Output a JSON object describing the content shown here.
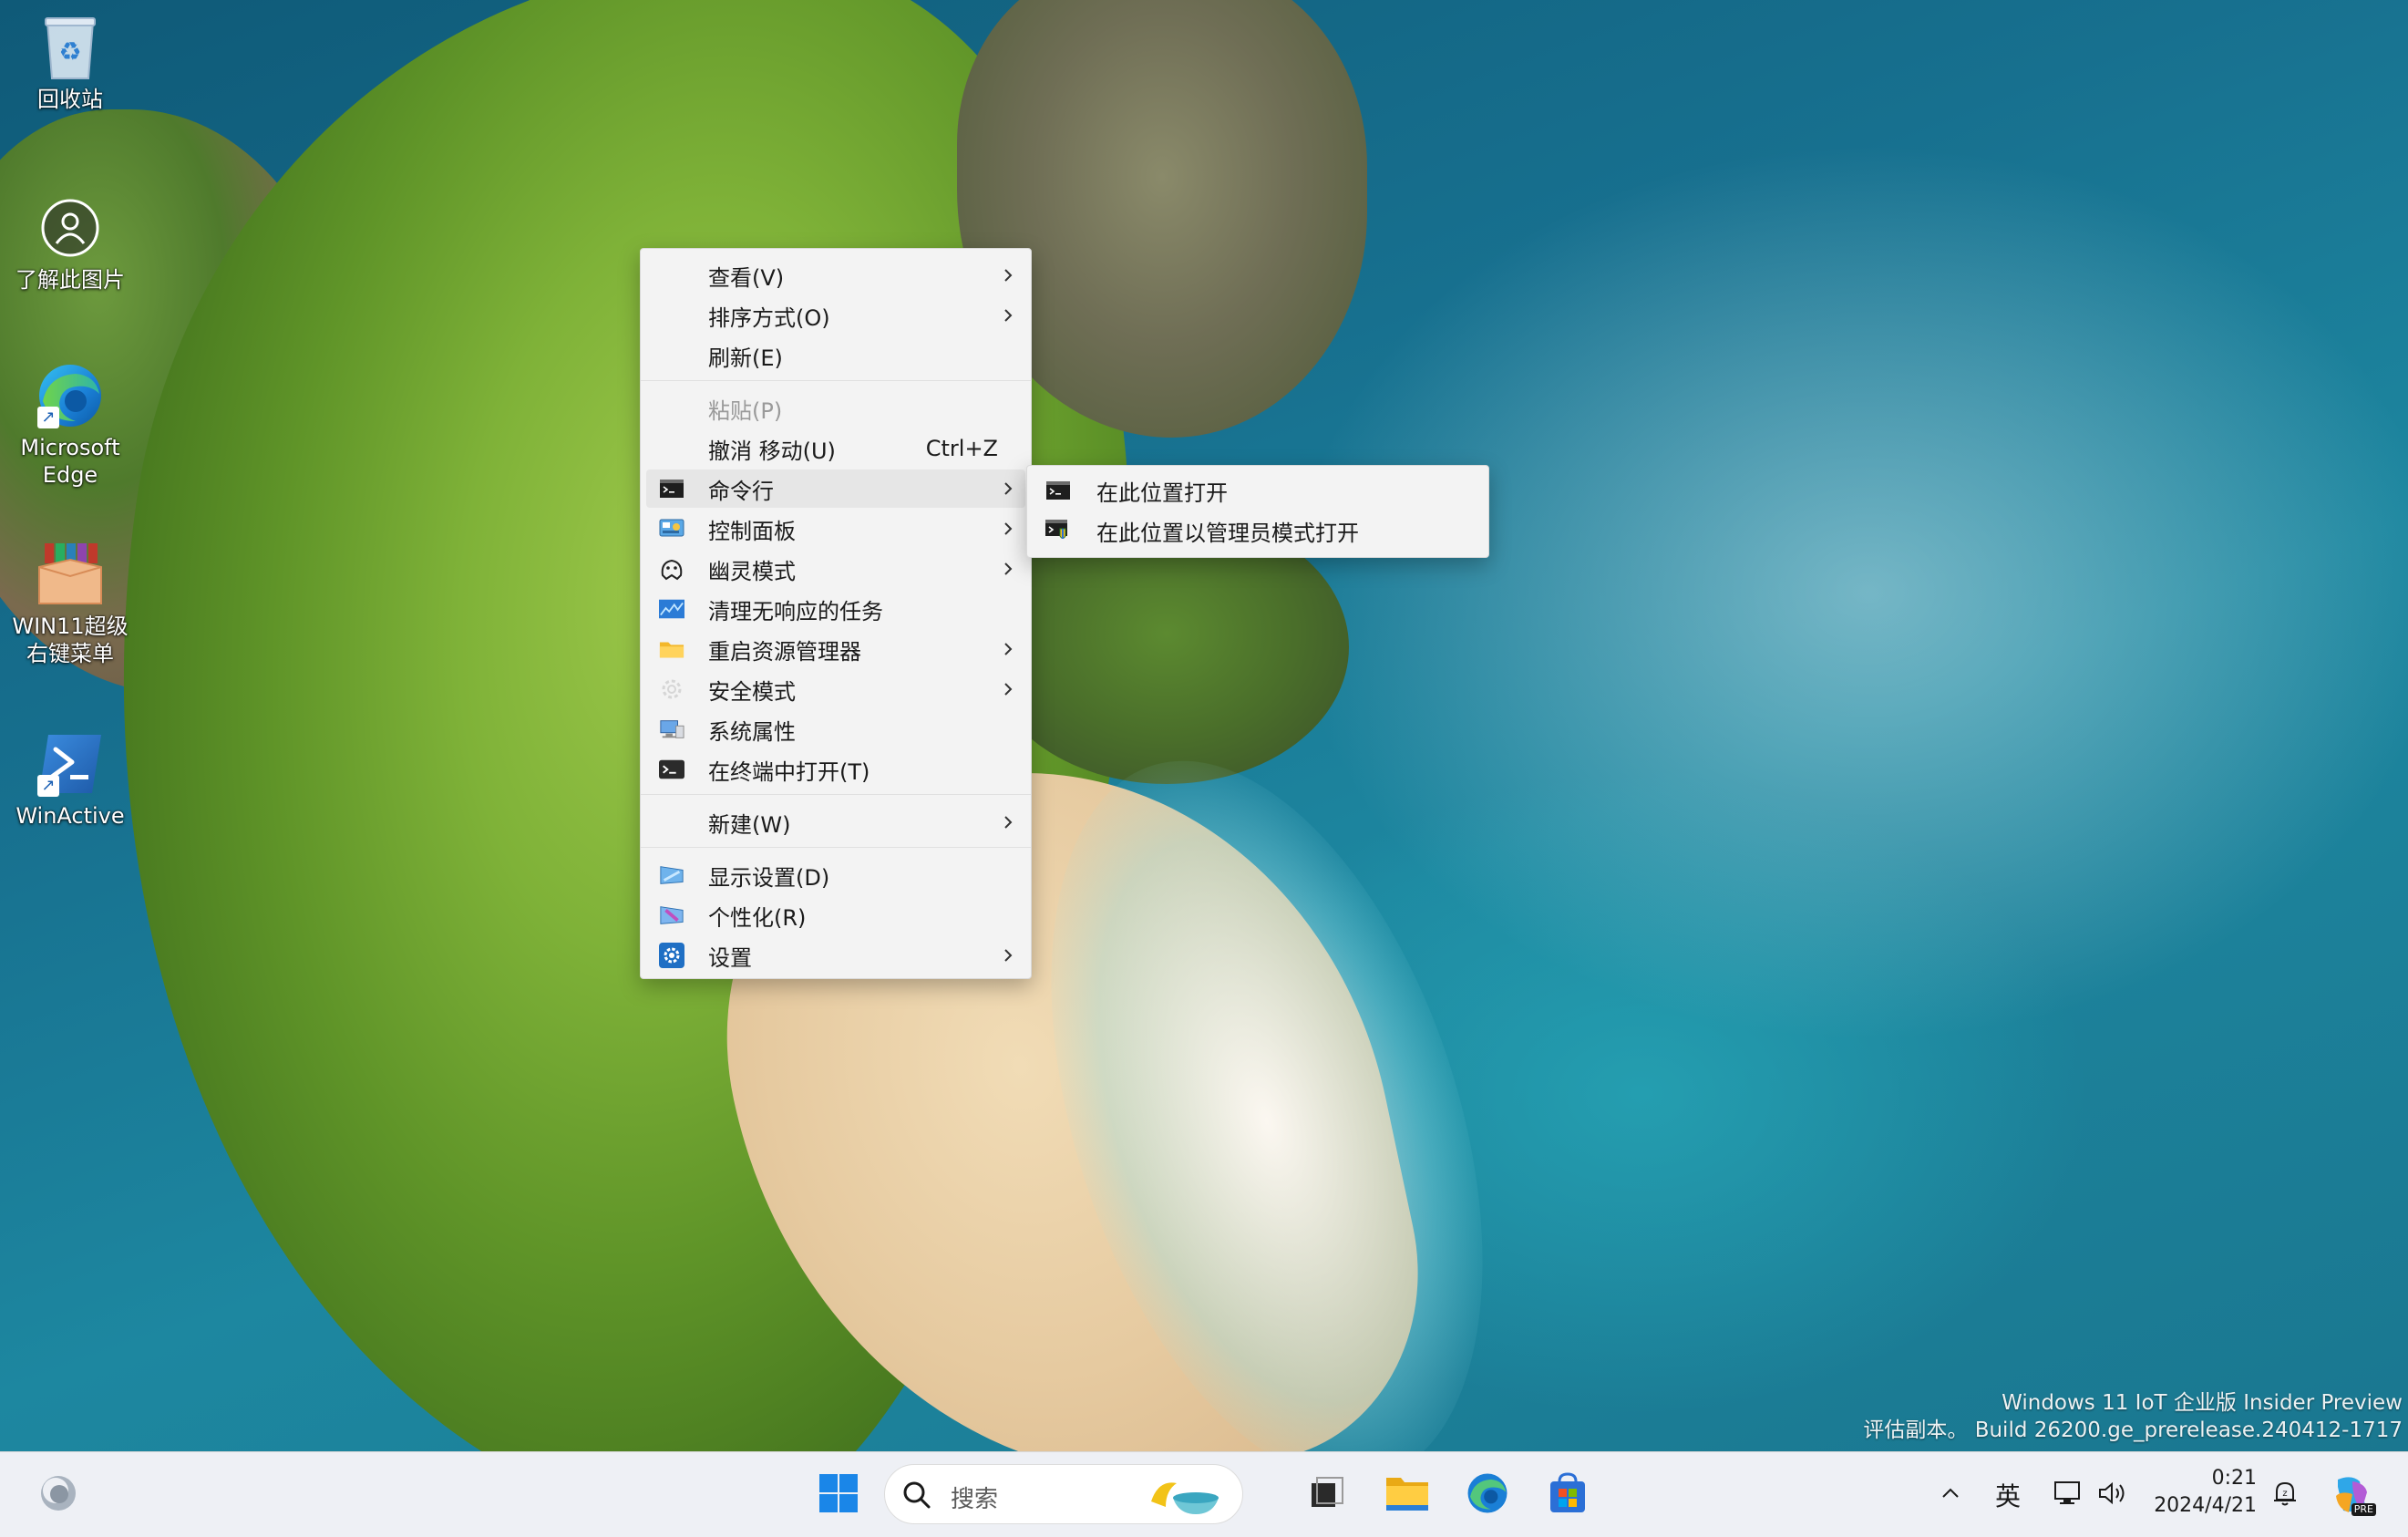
{
  "desktop": {
    "icons": [
      {
        "label": "回收站"
      },
      {
        "label": "了解此图片"
      },
      {
        "label": "Microsoft\nEdge"
      },
      {
        "label": "WIN11超级\n右键菜单"
      },
      {
        "label": "WinActive"
      }
    ]
  },
  "context_menu": {
    "items": [
      {
        "label": "查看(V)"
      },
      {
        "label": "排序方式(O)"
      },
      {
        "label": "刷新(E)"
      },
      {
        "label": "粘贴(P)"
      },
      {
        "label": "撤消 移动(U)",
        "shortcut": "Ctrl+Z"
      },
      {
        "label": "命令行"
      },
      {
        "label": "控制面板"
      },
      {
        "label": "幽灵模式"
      },
      {
        "label": "清理无响应的任务"
      },
      {
        "label": "重启资源管理器"
      },
      {
        "label": "安全模式"
      },
      {
        "label": "系统属性"
      },
      {
        "label": "在终端中打开(T)"
      },
      {
        "label": "新建(W)"
      },
      {
        "label": "显示设置(D)"
      },
      {
        "label": "个性化(R)"
      },
      {
        "label": "设置"
      }
    ]
  },
  "submenu": {
    "items": [
      {
        "label": "在此位置打开"
      },
      {
        "label": "在此位置以管理员模式打开"
      }
    ]
  },
  "watermark": {
    "line1": "Windows 11 IoT 企业版 Insider Preview",
    "line2": "评估副本。 Build 26200.ge_prerelease.240412-1717"
  },
  "taskbar": {
    "search_placeholder": "搜索",
    "ime_label": "英",
    "clock_time": "0:21",
    "clock_date": "2024/4/21",
    "copilot_badge": "PRE"
  },
  "colors": {
    "menu_bg": "#f3f3f3",
    "menu_hover": "#e6e6e6",
    "taskbar_bg": "#eef0f5",
    "accent_blue": "#0067c0"
  }
}
